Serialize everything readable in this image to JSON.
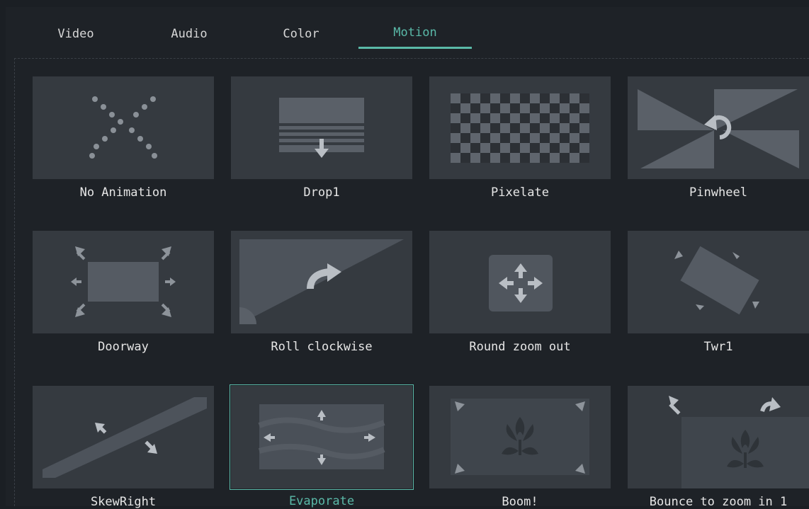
{
  "tabs": [
    {
      "label": "Video"
    },
    {
      "label": "Audio"
    },
    {
      "label": "Color"
    },
    {
      "label": "Motion",
      "active": true
    }
  ],
  "colors": {
    "accent": "#5ab9a8",
    "background": "#1e2227",
    "thumb": "#353a40",
    "label": "#e6e6e6"
  },
  "motions": [
    {
      "label": "No Animation",
      "icon": "no-animation-icon"
    },
    {
      "label": "Drop1",
      "icon": "drop-icon"
    },
    {
      "label": "Pixelate",
      "icon": "pixelate-icon"
    },
    {
      "label": "Pinwheel",
      "icon": "pinwheel-icon"
    },
    {
      "label": "Doorway",
      "icon": "doorway-icon"
    },
    {
      "label": "Roll clockwise",
      "icon": "roll-clockwise-icon"
    },
    {
      "label": "Round zoom out",
      "icon": "round-zoom-out-icon"
    },
    {
      "label": "Twr1",
      "icon": "twirl-icon"
    },
    {
      "label": "SkewRight",
      "icon": "skew-right-icon"
    },
    {
      "label": "Evaporate",
      "icon": "evaporate-icon",
      "selected": true
    },
    {
      "label": "Boom!",
      "icon": "boom-icon"
    },
    {
      "label": "Bounce to zoom in 1",
      "icon": "bounce-zoom-icon"
    }
  ]
}
